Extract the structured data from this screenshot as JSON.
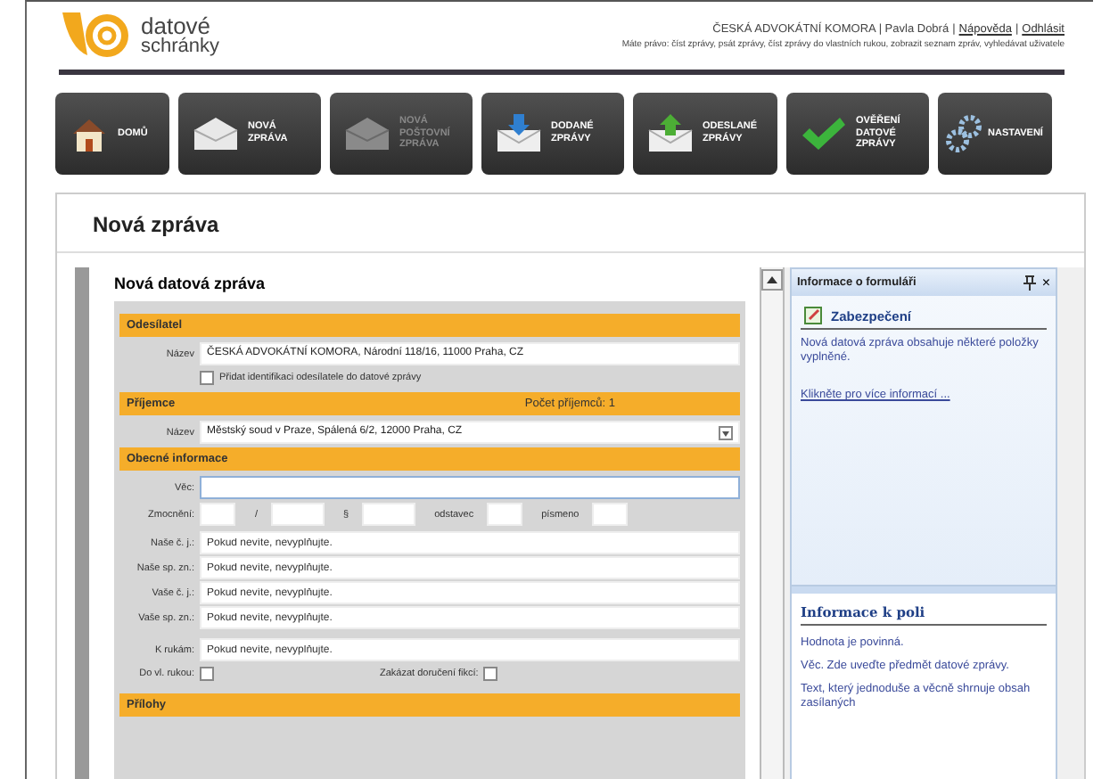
{
  "header": {
    "logo_top": "datové",
    "logo_bottom": "schránky",
    "user_info": "ČESKÁ ADVOKÁTNÍ KOMORA | Pavla Dobrá",
    "separator": "|",
    "links": [
      "Nápověda",
      "Odhlásit"
    ],
    "rights": "Máte právo: číst zprávy, psát zprávy, číst zprávy do vlastních rukou, zobrazit seznam zpráv, vyhledávat uživatele"
  },
  "nav": [
    {
      "kind": "home",
      "lines": [
        "DOMŮ"
      ],
      "disabled": false
    },
    {
      "kind": "envelope",
      "lines": [
        "NOVÁ",
        "ZPRÁVA"
      ],
      "disabled": false
    },
    {
      "kind": "envelope",
      "lines": [
        "NOVÁ",
        "POŠTOVNÍ",
        "ZPRÁVA"
      ],
      "disabled": true
    },
    {
      "kind": "inbox",
      "lines": [
        "DODANÉ",
        "ZPRÁVY"
      ],
      "disabled": false
    },
    {
      "kind": "outbox",
      "lines": [
        "ODESLANÉ",
        "ZPRÁVY"
      ],
      "disabled": false
    },
    {
      "kind": "check",
      "lines": [
        "OVĚŘENÍ",
        "DATOVÉ",
        "ZPRÁVY"
      ],
      "disabled": false
    },
    {
      "kind": "gears",
      "lines": [
        "NASTAVENÍ"
      ],
      "disabled": false
    }
  ],
  "page_title": "Nová zpráva",
  "form": {
    "title": "Nová datová zpráva",
    "sender": {
      "heading": "Odesílatel",
      "label": "Název",
      "value": "ČESKÁ ADVOKÁTNÍ KOMORA, Národní 118/16, 11000 Praha, CZ",
      "checkbox": {
        "label": "Přidat identifikaci odesílatele do datové zprávy",
        "checked": false
      }
    },
    "recipient": {
      "heading": "Příjemce",
      "count": "Počet příjemců: 1",
      "label": "Název",
      "value": "Městský soud v Praze, Spálená 6/2, 12000 Praha, CZ"
    },
    "general": {
      "heading": "Obecné informace",
      "subject_label": "Věc:",
      "mandate_label": "Zmocnění:",
      "mandate_parts": [
        "/",
        "§",
        "odstavec",
        "písmeno"
      ],
      "rows": [
        {
          "label": "Naše č. j.:",
          "placeholder": "Pokud nevíte, nevyplňujte."
        },
        {
          "label": "Naše sp. zn.:",
          "placeholder": "Pokud nevíte, nevyplňujte."
        },
        {
          "label": "Vaše č. j.:",
          "placeholder": "Pokud nevíte, nevyplňujte."
        },
        {
          "label": "Vaše sp. zn.:",
          "placeholder": "Pokud nevíte, nevyplňujte."
        },
        {
          "label": "K rukám:",
          "placeholder": "Pokud nevíte, nevyplňujte."
        }
      ],
      "checks": [
        {
          "label": "Do vl. rukou:",
          "checked": false
        },
        {
          "label": "Zakázat doručení fikcí:",
          "checked": false
        }
      ]
    },
    "attachments": {
      "heading": "Přílohy"
    }
  },
  "info_panel": {
    "title": "Informace o formuláři",
    "close": "×",
    "section": "Zabezpečení",
    "text": "Nová datová zpráva obsahuje některé položky vyplněné.",
    "link": "Klikněte pro více informací ...",
    "field_heading": "Informace k poli",
    "field_texts": [
      "Hodnota je povinná.",
      "Věc. Zde uveďte předmět datové zprávy.",
      "Text, který jednoduše a věcně shrnuje obsah zasílaných"
    ]
  }
}
